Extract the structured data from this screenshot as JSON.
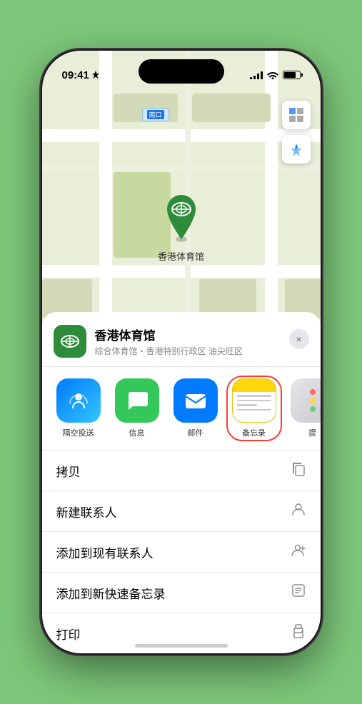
{
  "status": {
    "time": "09:41",
    "location_arrow": "▶"
  },
  "map": {
    "label_prefix": "南口",
    "stadium_name": "香港体育馆"
  },
  "sheet": {
    "venue_name": "香港体育馆",
    "venue_subtitle": "综合体育馆・香港特别行政区 油尖旺区",
    "close_label": "×"
  },
  "share_items": [
    {
      "id": "airdrop",
      "label": "隔空投送"
    },
    {
      "id": "messages",
      "label": "信息"
    },
    {
      "id": "mail",
      "label": "邮件"
    },
    {
      "id": "notes",
      "label": "备忘录"
    },
    {
      "id": "more",
      "label": "提"
    }
  ],
  "actions": [
    {
      "label": "拷贝",
      "icon": "copy"
    },
    {
      "label": "新建联系人",
      "icon": "person"
    },
    {
      "label": "添加到现有联系人",
      "icon": "person-add"
    },
    {
      "label": "添加到新快速备忘录",
      "icon": "note"
    },
    {
      "label": "打印",
      "icon": "print"
    }
  ]
}
